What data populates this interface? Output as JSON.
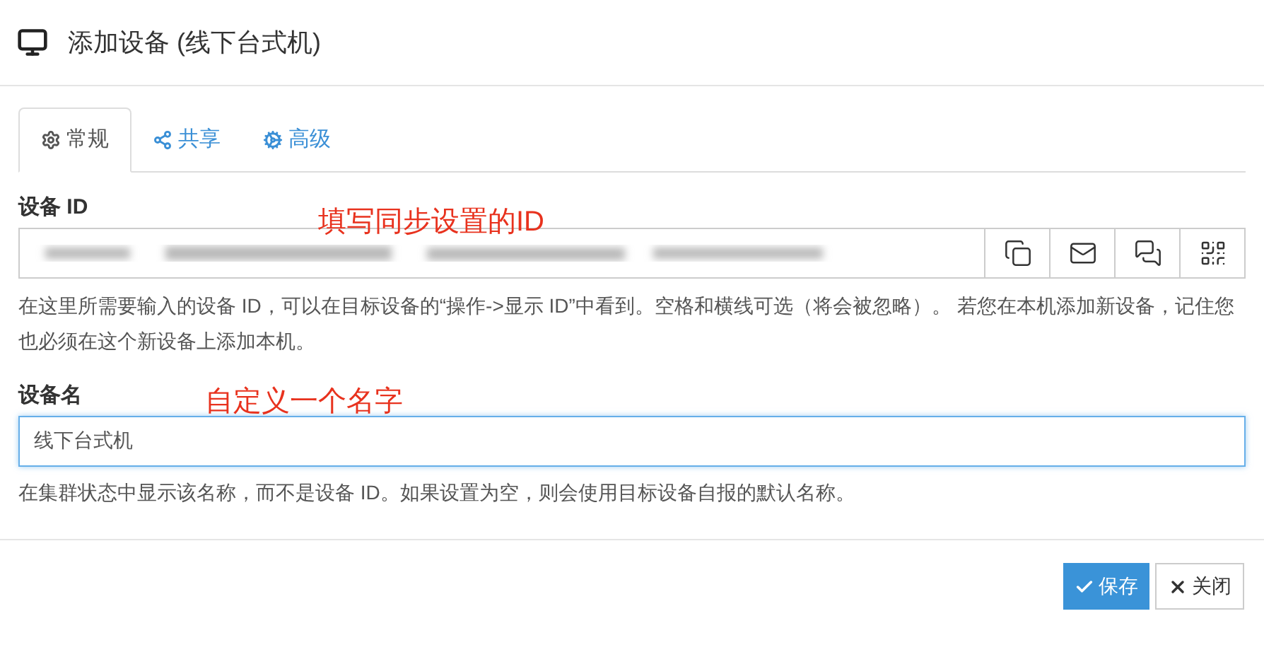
{
  "dialog": {
    "title": "添加设备 (线下台式机)"
  },
  "tabs": [
    {
      "label": "常规",
      "selected": true
    },
    {
      "label": "共享",
      "selected": false
    },
    {
      "label": "高级",
      "selected": false
    }
  ],
  "device_id": {
    "label": "设备 ID",
    "annotation": "填写同步设置的ID",
    "help": "在这里所需要输入的设备 ID，可以在目标设备的“操作->显示 ID”中看到。空格和横线可选（将会被忽略）。 若您在本机添加新设备，记住您也必须在这个新设备上添加本机。"
  },
  "device_name": {
    "label": "设备名",
    "annotation": "自定义一个名字",
    "value": "线下台式机",
    "focused": true,
    "help": "在集群状态中显示该名称，而不是设备 ID。如果设置为空，则会使用目标设备自报的默认名称。"
  },
  "buttons": [
    {
      "label": "保存",
      "kind": "primary"
    },
    {
      "label": "关闭",
      "kind": "default"
    }
  ]
}
